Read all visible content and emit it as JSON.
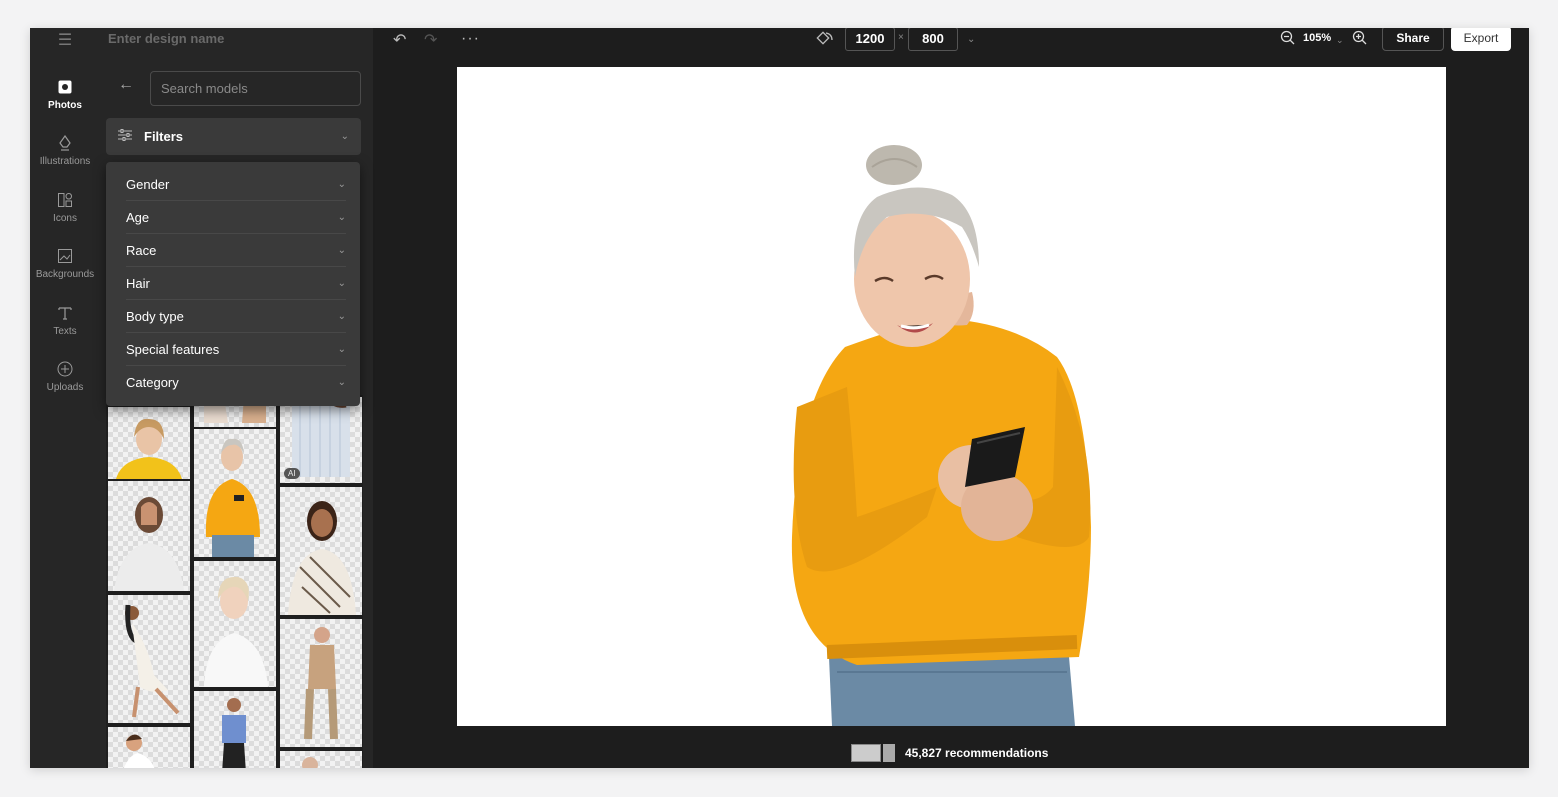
{
  "app": {
    "design_name_placeholder": "Enter design name"
  },
  "rail": {
    "items": [
      {
        "label": "Photos",
        "icon": "photo-icon",
        "active": true
      },
      {
        "label": "Illustrations",
        "icon": "pen-nib-icon",
        "active": false
      },
      {
        "label": "Icons",
        "icon": "shapes-icon",
        "active": false
      },
      {
        "label": "Backgrounds",
        "icon": "image-icon",
        "active": false
      },
      {
        "label": "Texts",
        "icon": "text-icon",
        "active": false
      },
      {
        "label": "Uploads",
        "icon": "upload-icon",
        "active": false
      }
    ]
  },
  "panel": {
    "search_placeholder": "Search models",
    "filters_label": "Filters",
    "filter_options": [
      "Gender",
      "Age",
      "Race",
      "Hair",
      "Body type",
      "Special features",
      "Category"
    ],
    "ai_badge": "AI"
  },
  "toolbar": {
    "width": "1200",
    "height": "800",
    "times": "×",
    "zoom": "105%",
    "share_label": "Share",
    "export_label": "Export"
  },
  "footer": {
    "recommendations": "45,827 recommendations"
  },
  "colors": {
    "sweater": "#f5a712",
    "jeans": "#6b8aa5",
    "hair": "#c9c6c0"
  }
}
